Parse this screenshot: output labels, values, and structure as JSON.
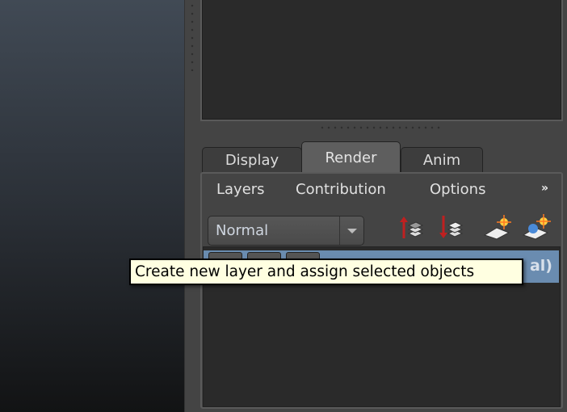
{
  "tabs": [
    {
      "label": "Display"
    },
    {
      "label": "Render",
      "active": true
    },
    {
      "label": "Anim"
    }
  ],
  "menu": {
    "items": [
      "Layers",
      "Contribution",
      "Options"
    ],
    "overflow": "»"
  },
  "layer_mode": {
    "selected": "Normal"
  },
  "toolbar": {
    "icons": [
      "move-layer-up-icon",
      "move-layer-down-icon",
      "create-empty-layer-icon",
      "create-layer-from-selected-icon"
    ]
  },
  "layer_list": {
    "selected_row_visible_text": "al)",
    "selected_color": "#6a8cb0"
  },
  "tooltip": {
    "text": "Create new layer and assign selected objects"
  }
}
